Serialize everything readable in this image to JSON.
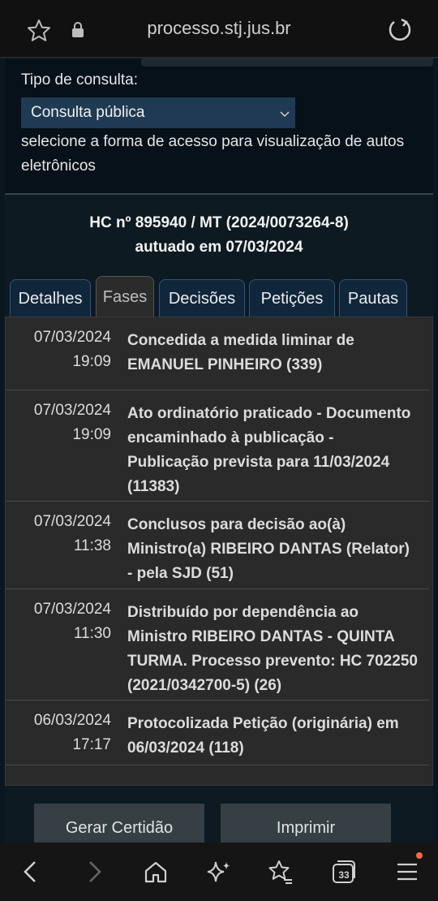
{
  "browser": {
    "url": "processo.stj.jus.br",
    "tab_count": "33"
  },
  "access": {
    "tipo_label": "Tipo de consulta:",
    "select_value": "Consulta pública",
    "hint": "selecione a forma de acesso para visualização de autos eletrônicos"
  },
  "process": {
    "title_line1": "HC nº 895940 / MT (2024/0073264-8)",
    "title_line2": "autuado em 07/03/2024"
  },
  "tabs": [
    {
      "label": "Detalhes"
    },
    {
      "label": "Fases"
    },
    {
      "label": "Decisões"
    },
    {
      "label": "Petições"
    },
    {
      "label": "Pautas"
    }
  ],
  "active_tab": "Fases",
  "phases": [
    {
      "date": "07/03/2024",
      "time": "19:09",
      "desc": "Concedida a medida liminar de EMANUEL PINHEIRO (339)"
    },
    {
      "date": "07/03/2024",
      "time": "19:09",
      "desc": "Ato ordinatório praticado - Documento encaminhado à publicação - Publicação prevista para 11/03/2024 (11383)"
    },
    {
      "date": "07/03/2024",
      "time": "11:38",
      "desc": "Conclusos para decisão ao(à) Ministro(a) RIBEIRO DANTAS (Relator) - pela SJD (51)"
    },
    {
      "date": "07/03/2024",
      "time": "11:30",
      "desc": "Distribuído por dependência ao Ministro RIBEIRO DANTAS - QUINTA TURMA. Processo prevento: HC 702250 (2021/0342700-5) (26)"
    },
    {
      "date": "06/03/2024",
      "time": "17:17",
      "desc": "Protocolizada Petição (originária) em 06/03/2024 (118)"
    }
  ],
  "actions": {
    "certidao": "Gerar Certidão",
    "imprimir": "Imprimir"
  },
  "colors": {
    "page_bg": "#0b1720",
    "select_bg": "#1f3a52",
    "list_bg": "#2a2a2a",
    "notification_dot": "#ff6a3d"
  }
}
